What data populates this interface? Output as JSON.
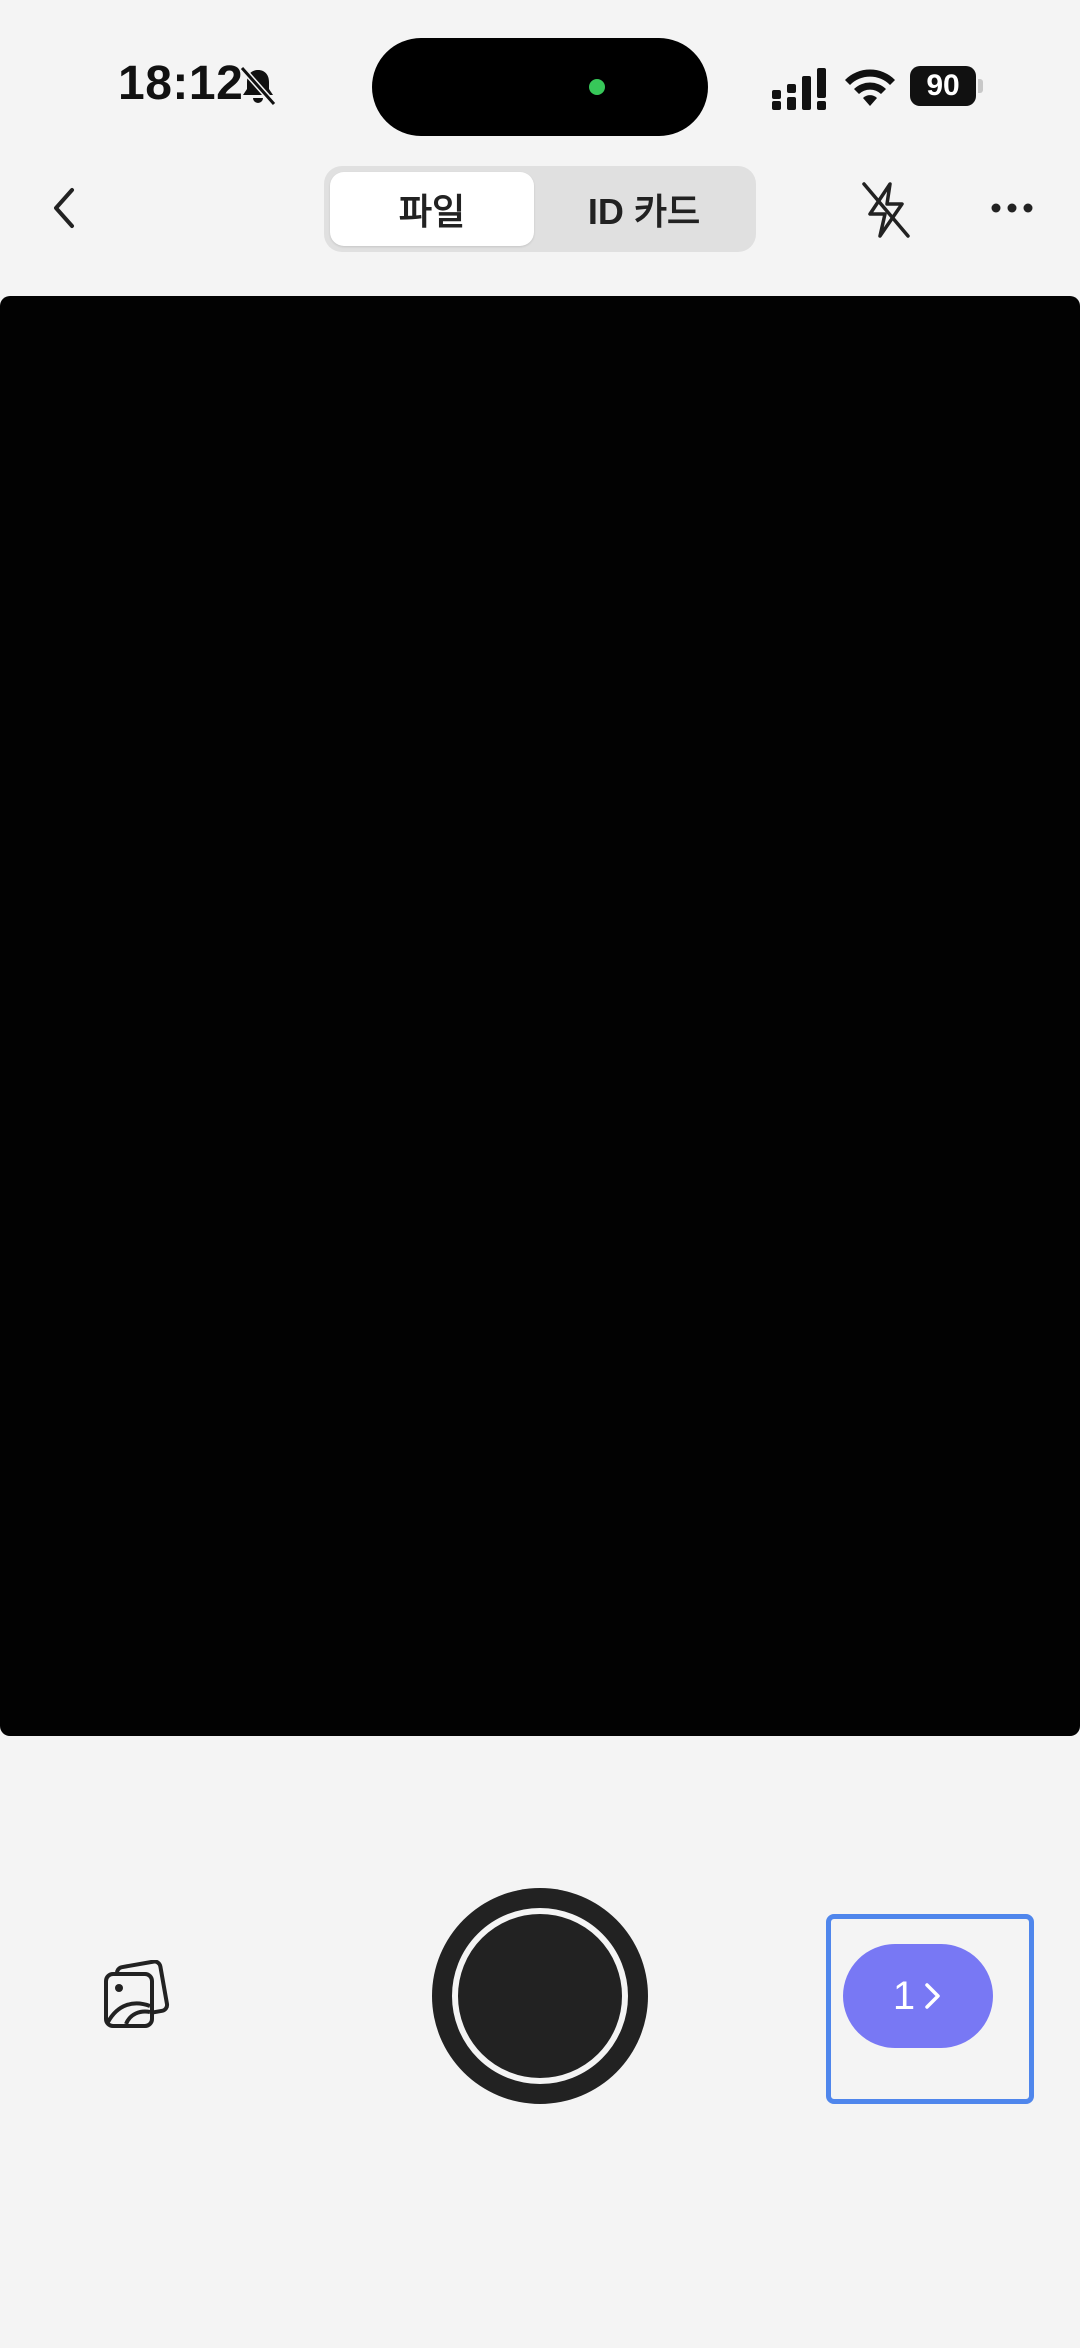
{
  "status_bar": {
    "time": "18:12",
    "battery_level": "90",
    "icons": [
      "bell-slash-icon",
      "cellular-signal-icon",
      "wifi-icon",
      "battery-icon"
    ]
  },
  "nav": {
    "back_icon": "chevron-left-icon",
    "tabs": [
      {
        "label": "파일",
        "selected": true
      },
      {
        "label": "ID 카드",
        "selected": false
      }
    ],
    "flash_icon": "flash-off-icon",
    "more_icon": "ellipsis-icon"
  },
  "bottom": {
    "gallery_icon": "gallery-stack-icon",
    "page_count": "1",
    "page_button_icon": "chevron-right-icon"
  },
  "colors": {
    "background": "#f4f4f4",
    "viewfinder": "#020202",
    "accent": "#7878f4",
    "highlight_border": "#4f86ec",
    "shutter": "#222222",
    "camera_indicator": "#37c759"
  }
}
